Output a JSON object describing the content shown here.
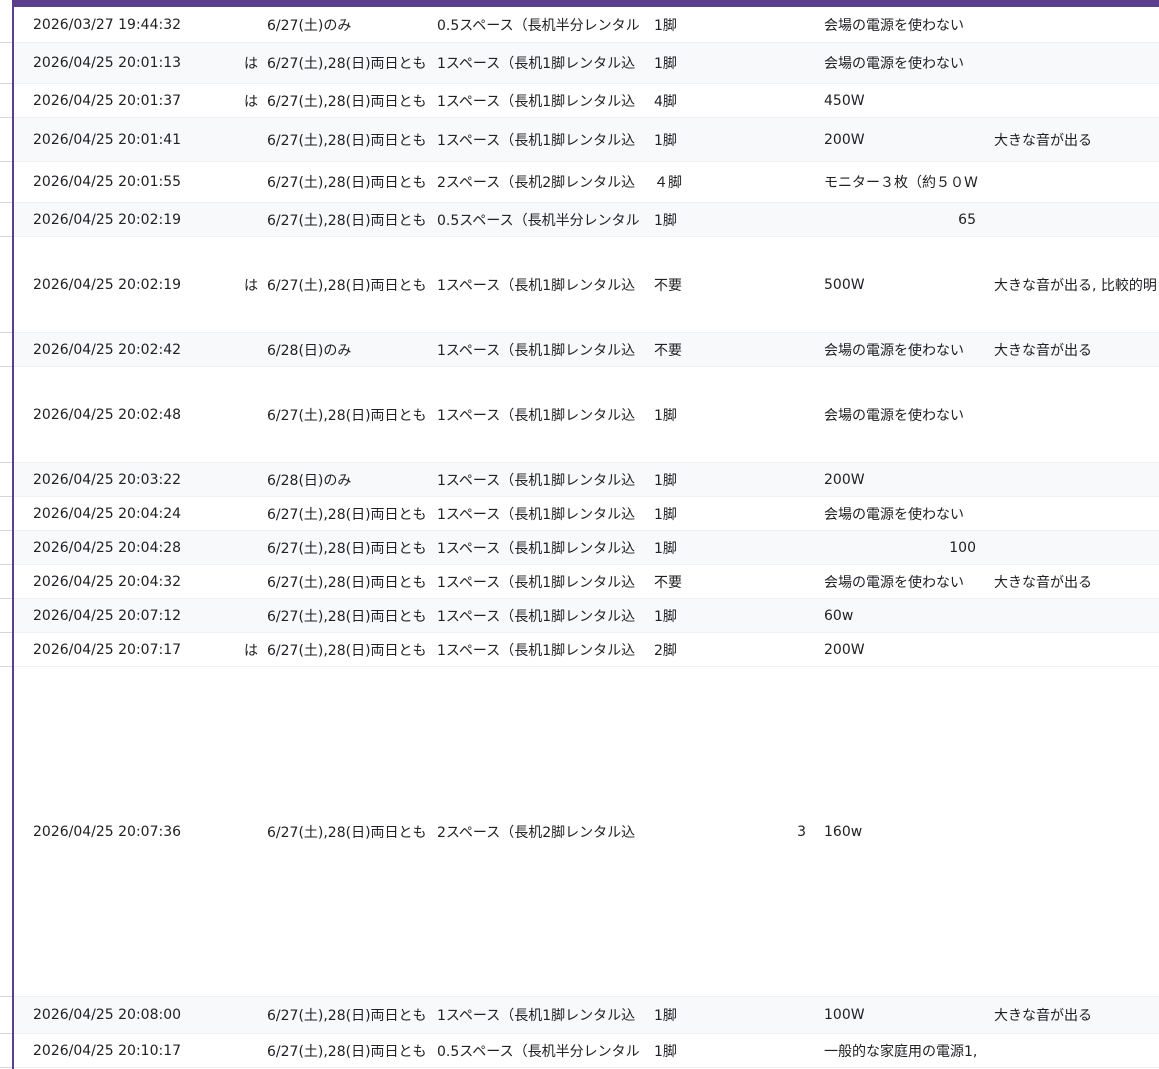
{
  "rows": [
    {
      "h": 36,
      "alt": false,
      "timestamp": "2026/03/27 19:44:32",
      "flag": "",
      "days": "6/27(土)のみ",
      "space": "0.5スペース（長机半分レンタル",
      "desk": "1脚",
      "num": "",
      "power": "会場の電源を使わない",
      "power_num": "",
      "sound": ""
    },
    {
      "h": 41,
      "alt": true,
      "timestamp": "2026/04/25 20:01:13",
      "flag": "は",
      "days": "6/27(土),28(日)両日とも",
      "space": "1スペース（長机1脚レンタル込",
      "desk": "1脚",
      "num": "",
      "power": "会場の電源を使わない",
      "power_num": "",
      "sound": ""
    },
    {
      "h": 34,
      "alt": false,
      "timestamp": "2026/04/25 20:01:37",
      "flag": "は",
      "days": "6/27(土),28(日)両日とも",
      "space": "1スペース（長机1脚レンタル込",
      "desk": "4脚",
      "num": "",
      "power": "450W",
      "power_num": "",
      "sound": ""
    },
    {
      "h": 44,
      "alt": true,
      "timestamp": "2026/04/25 20:01:41",
      "flag": "",
      "days": "6/27(土),28(日)両日とも",
      "space": "1スペース（長机1脚レンタル込",
      "desk": "1脚",
      "num": "",
      "power": "200W",
      "power_num": "",
      "sound": "大きな音が出る"
    },
    {
      "h": 41,
      "alt": false,
      "timestamp": "2026/04/25 20:01:55",
      "flag": "",
      "days": "6/27(土),28(日)両日とも",
      "space": "2スペース（長机2脚レンタル込",
      "desk": "４脚",
      "num": "",
      "power": "モニター３枚（約５０W",
      "power_num": "",
      "sound": ""
    },
    {
      "h": 34,
      "alt": true,
      "timestamp": "2026/04/25 20:02:19",
      "flag": "",
      "days": "6/27(土),28(日)両日とも",
      "space": "0.5スペース（長机半分レンタル",
      "desk": "1脚",
      "num": "",
      "power": "",
      "power_num": "65",
      "sound": ""
    },
    {
      "h": 96,
      "alt": false,
      "timestamp": "2026/04/25 20:02:19",
      "flag": "は",
      "days": "6/27(土),28(日)両日とも",
      "space": "1スペース（長机1脚レンタル込",
      "desk": "不要",
      "num": "",
      "power": "500W",
      "power_num": "",
      "sound": "大きな音が出る, 比較的明"
    },
    {
      "h": 34,
      "alt": true,
      "timestamp": "2026/04/25 20:02:42",
      "flag": "",
      "days": "6/28(日)のみ",
      "space": "1スペース（長机1脚レンタル込",
      "desk": "不要",
      "num": "",
      "power": "会場の電源を使わない",
      "power_num": "",
      "sound": "大きな音が出る"
    },
    {
      "h": 96,
      "alt": false,
      "timestamp": "2026/04/25 20:02:48",
      "flag": "",
      "days": "6/27(土),28(日)両日とも",
      "space": "1スペース（長机1脚レンタル込",
      "desk": "1脚",
      "num": "",
      "power": "会場の電源を使わない",
      "power_num": "",
      "sound": ""
    },
    {
      "h": 34,
      "alt": true,
      "timestamp": "2026/04/25 20:03:22",
      "flag": "",
      "days": "6/28(日)のみ",
      "space": "1スペース（長机1脚レンタル込",
      "desk": "1脚",
      "num": "",
      "power": "200W",
      "power_num": "",
      "sound": ""
    },
    {
      "h": 34,
      "alt": false,
      "timestamp": "2026/04/25 20:04:24",
      "flag": "",
      "days": "6/27(土),28(日)両日とも",
      "space": "1スペース（長机1脚レンタル込",
      "desk": "1脚",
      "num": "",
      "power": "会場の電源を使わない",
      "power_num": "",
      "sound": ""
    },
    {
      "h": 34,
      "alt": true,
      "timestamp": "2026/04/25 20:04:28",
      "flag": "",
      "days": "6/27(土),28(日)両日とも",
      "space": "1スペース（長机1脚レンタル込",
      "desk": "1脚",
      "num": "",
      "power": "",
      "power_num": "100",
      "sound": ""
    },
    {
      "h": 34,
      "alt": false,
      "timestamp": "2026/04/25 20:04:32",
      "flag": "",
      "days": "6/27(土),28(日)両日とも",
      "space": "1スペース（長机1脚レンタル込",
      "desk": "不要",
      "num": "",
      "power": "会場の電源を使わない",
      "power_num": "",
      "sound": "大きな音が出る"
    },
    {
      "h": 34,
      "alt": true,
      "timestamp": "2026/04/25 20:07:12",
      "flag": "",
      "days": "6/27(土),28(日)両日とも",
      "space": "1スペース（長机1脚レンタル込",
      "desk": "1脚",
      "num": "",
      "power": "60w",
      "power_num": "",
      "sound": ""
    },
    {
      "h": 34,
      "alt": false,
      "timestamp": "2026/04/25 20:07:17",
      "flag": "は",
      "days": "6/27(土),28(日)両日とも",
      "space": "1スペース（長机1脚レンタル込",
      "desk": "2脚",
      "num": "",
      "power": "200W",
      "power_num": "",
      "sound": ""
    },
    {
      "h": 330,
      "alt": false,
      "timestamp": "2026/04/25 20:07:36",
      "flag": "",
      "days": "6/27(土),28(日)両日とも",
      "space": "2スペース（長机2脚レンタル込",
      "desk": "",
      "num": "3",
      "power": "160w",
      "power_num": "",
      "sound": ""
    },
    {
      "h": 37,
      "alt": true,
      "timestamp": "2026/04/25 20:08:00",
      "flag": "",
      "days": "6/27(土),28(日)両日とも",
      "space": "1スペース（長机1脚レンタル込",
      "desk": "1脚",
      "num": "",
      "power": "100W",
      "power_num": "",
      "sound": "大きな音が出る"
    },
    {
      "h": 34,
      "alt": false,
      "timestamp": "2026/04/25 20:10:17",
      "flag": "",
      "days": "6/27(土),28(日)両日とも",
      "space": "0.5スペース（長机半分レンタル",
      "desk": "1脚",
      "num": "",
      "power": "一般的な家庭用の電源1,",
      "power_num": "",
      "sound": ""
    }
  ]
}
